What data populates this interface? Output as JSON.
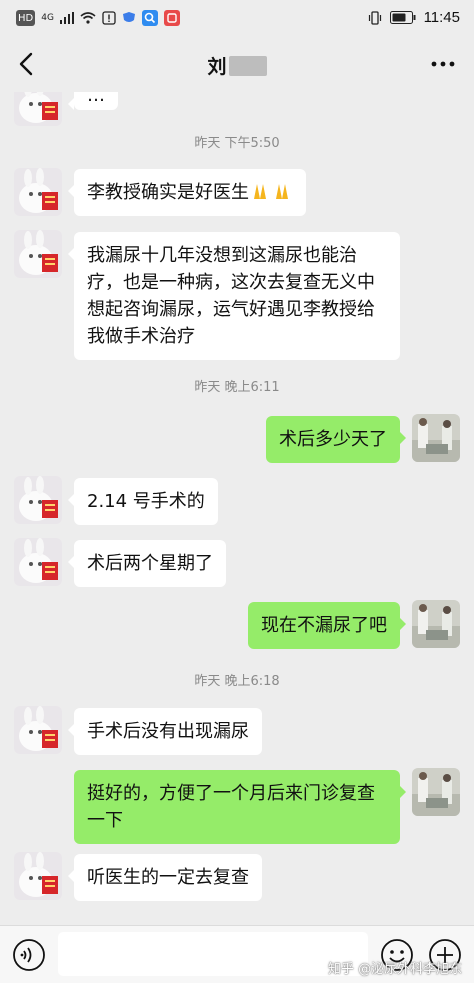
{
  "status_bar": {
    "network_badge": "HD",
    "signal_label": "4G",
    "time": "11:45"
  },
  "header": {
    "title": "刘",
    "back_icon": "chevron-left-icon",
    "more_icon": "more-dots-icon"
  },
  "messages": [
    {
      "kind": "incoming",
      "text": "…"
    },
    {
      "kind": "timestamp",
      "text": "昨天 下午5:50"
    },
    {
      "kind": "incoming",
      "text": "李教授确实是好医生",
      "emoji": "praying-hands"
    },
    {
      "kind": "incoming",
      "text": "我漏尿十几年没想到这漏尿也能治疗，也是一种病，这次去复查无义中想起咨询漏尿，运气好遇见李教授给我做手术治疗"
    },
    {
      "kind": "timestamp",
      "text": "昨天 晚上6:11"
    },
    {
      "kind": "outgoing",
      "text": "术后多少天了"
    },
    {
      "kind": "incoming",
      "text": "2.14 号手术的"
    },
    {
      "kind": "incoming",
      "text": "术后两个星期了"
    },
    {
      "kind": "outgoing",
      "text": "现在不漏尿了吧"
    },
    {
      "kind": "timestamp",
      "text": "昨天 晚上6:18"
    },
    {
      "kind": "incoming",
      "text": "手术后没有出现漏尿"
    },
    {
      "kind": "outgoing",
      "text": "挺好的，方便了一个月后来门诊复查一下"
    },
    {
      "kind": "incoming",
      "text": "听医生的一定去复查"
    }
  ],
  "input_bar": {
    "voice_icon": "voice-icon",
    "emoji_icon": "emoji-icon",
    "plus_icon": "plus-icon"
  },
  "watermark": "知乎 @泌尿外科李旭东",
  "colors": {
    "background": "#ededed",
    "outgoing_bubble": "#95ec69",
    "incoming_bubble": "#ffffff",
    "timestamp_text": "#8a8a8a"
  }
}
